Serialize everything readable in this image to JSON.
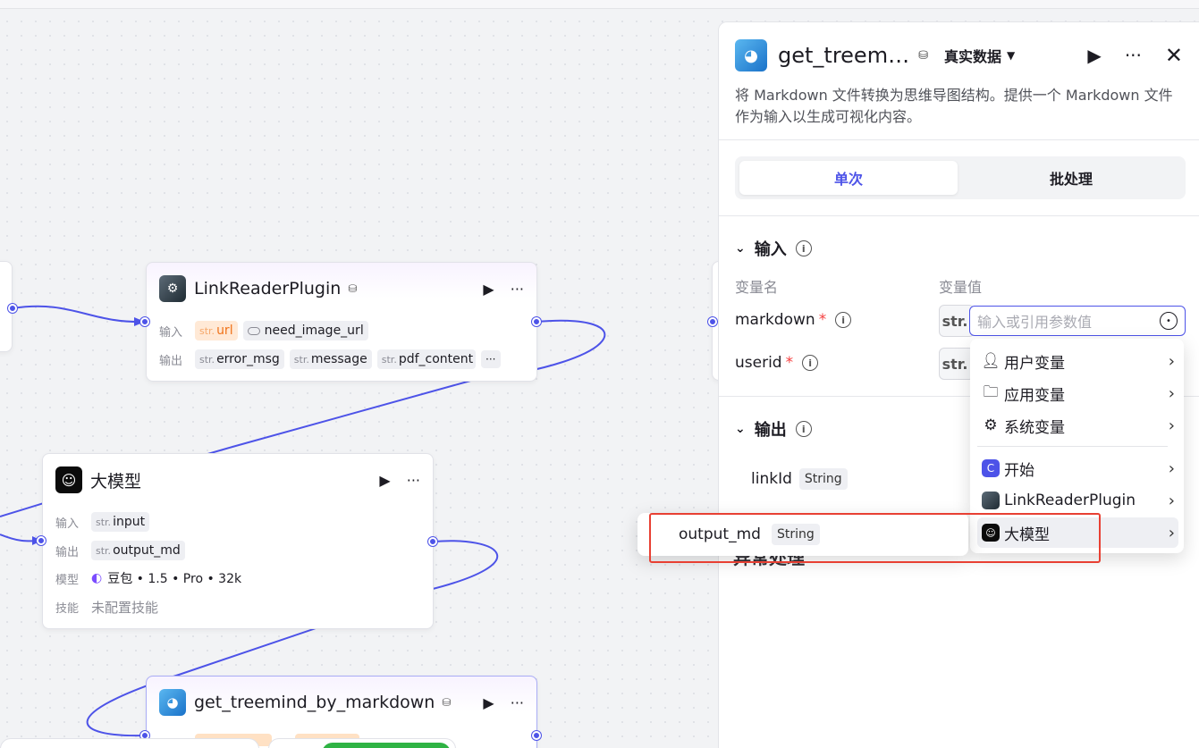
{
  "nodes": {
    "linkreader": {
      "title": "LinkReaderPlugin",
      "input_label": "输入",
      "output_label": "输出",
      "inputs": [
        {
          "type": "str.",
          "name": "url"
        },
        {
          "type": "toggle",
          "name": "need_image_url"
        }
      ],
      "outputs": [
        {
          "type": "str.",
          "name": "error_msg"
        },
        {
          "type": "str.",
          "name": "message"
        },
        {
          "type": "str.",
          "name": "pdf_content"
        }
      ],
      "more": "···"
    },
    "llm": {
      "title": "大模型",
      "input_label": "输入",
      "output_label": "输出",
      "model_label": "模型",
      "skill_label": "技能",
      "input": {
        "type": "str.",
        "name": "input"
      },
      "output": {
        "type": "str.",
        "name": "output_md"
      },
      "model": "豆包 • 1.5 • Pro • 32k",
      "skill": "未配置技能"
    },
    "treemind": {
      "title": "get_treemind_by_markdown"
    }
  },
  "panel": {
    "title": "get_treem…",
    "env": "真实数据",
    "description": "将 Markdown 文件转换为思维导图结构。提供一个 Markdown 文件作为输入以生成可视化内容。",
    "tabs": [
      "单次",
      "批处理"
    ],
    "input_section": "输入",
    "col_name": "变量名",
    "col_value": "变量值",
    "vars": [
      {
        "name": "markdown",
        "type": "str."
      },
      {
        "name": "userid",
        "type": "str."
      }
    ],
    "input_placeholder": "输入或引用参数值",
    "output_section": "输出",
    "output_var": {
      "name": "linkId",
      "type": "String"
    },
    "exception_section": "异常处理"
  },
  "menu": {
    "items": [
      {
        "icon": "user-icon",
        "label": "用户变量"
      },
      {
        "icon": "folder-icon",
        "label": "应用变量"
      },
      {
        "icon": "gear-icon",
        "label": "系统变量"
      },
      {
        "icon": "start-icon",
        "label": "开始"
      },
      {
        "icon": "plugin-icon",
        "label": "LinkReaderPlugin"
      },
      {
        "icon": "llm-icon",
        "label": "大模型"
      }
    ],
    "submenu": {
      "name": "output_md",
      "type": "String"
    }
  }
}
